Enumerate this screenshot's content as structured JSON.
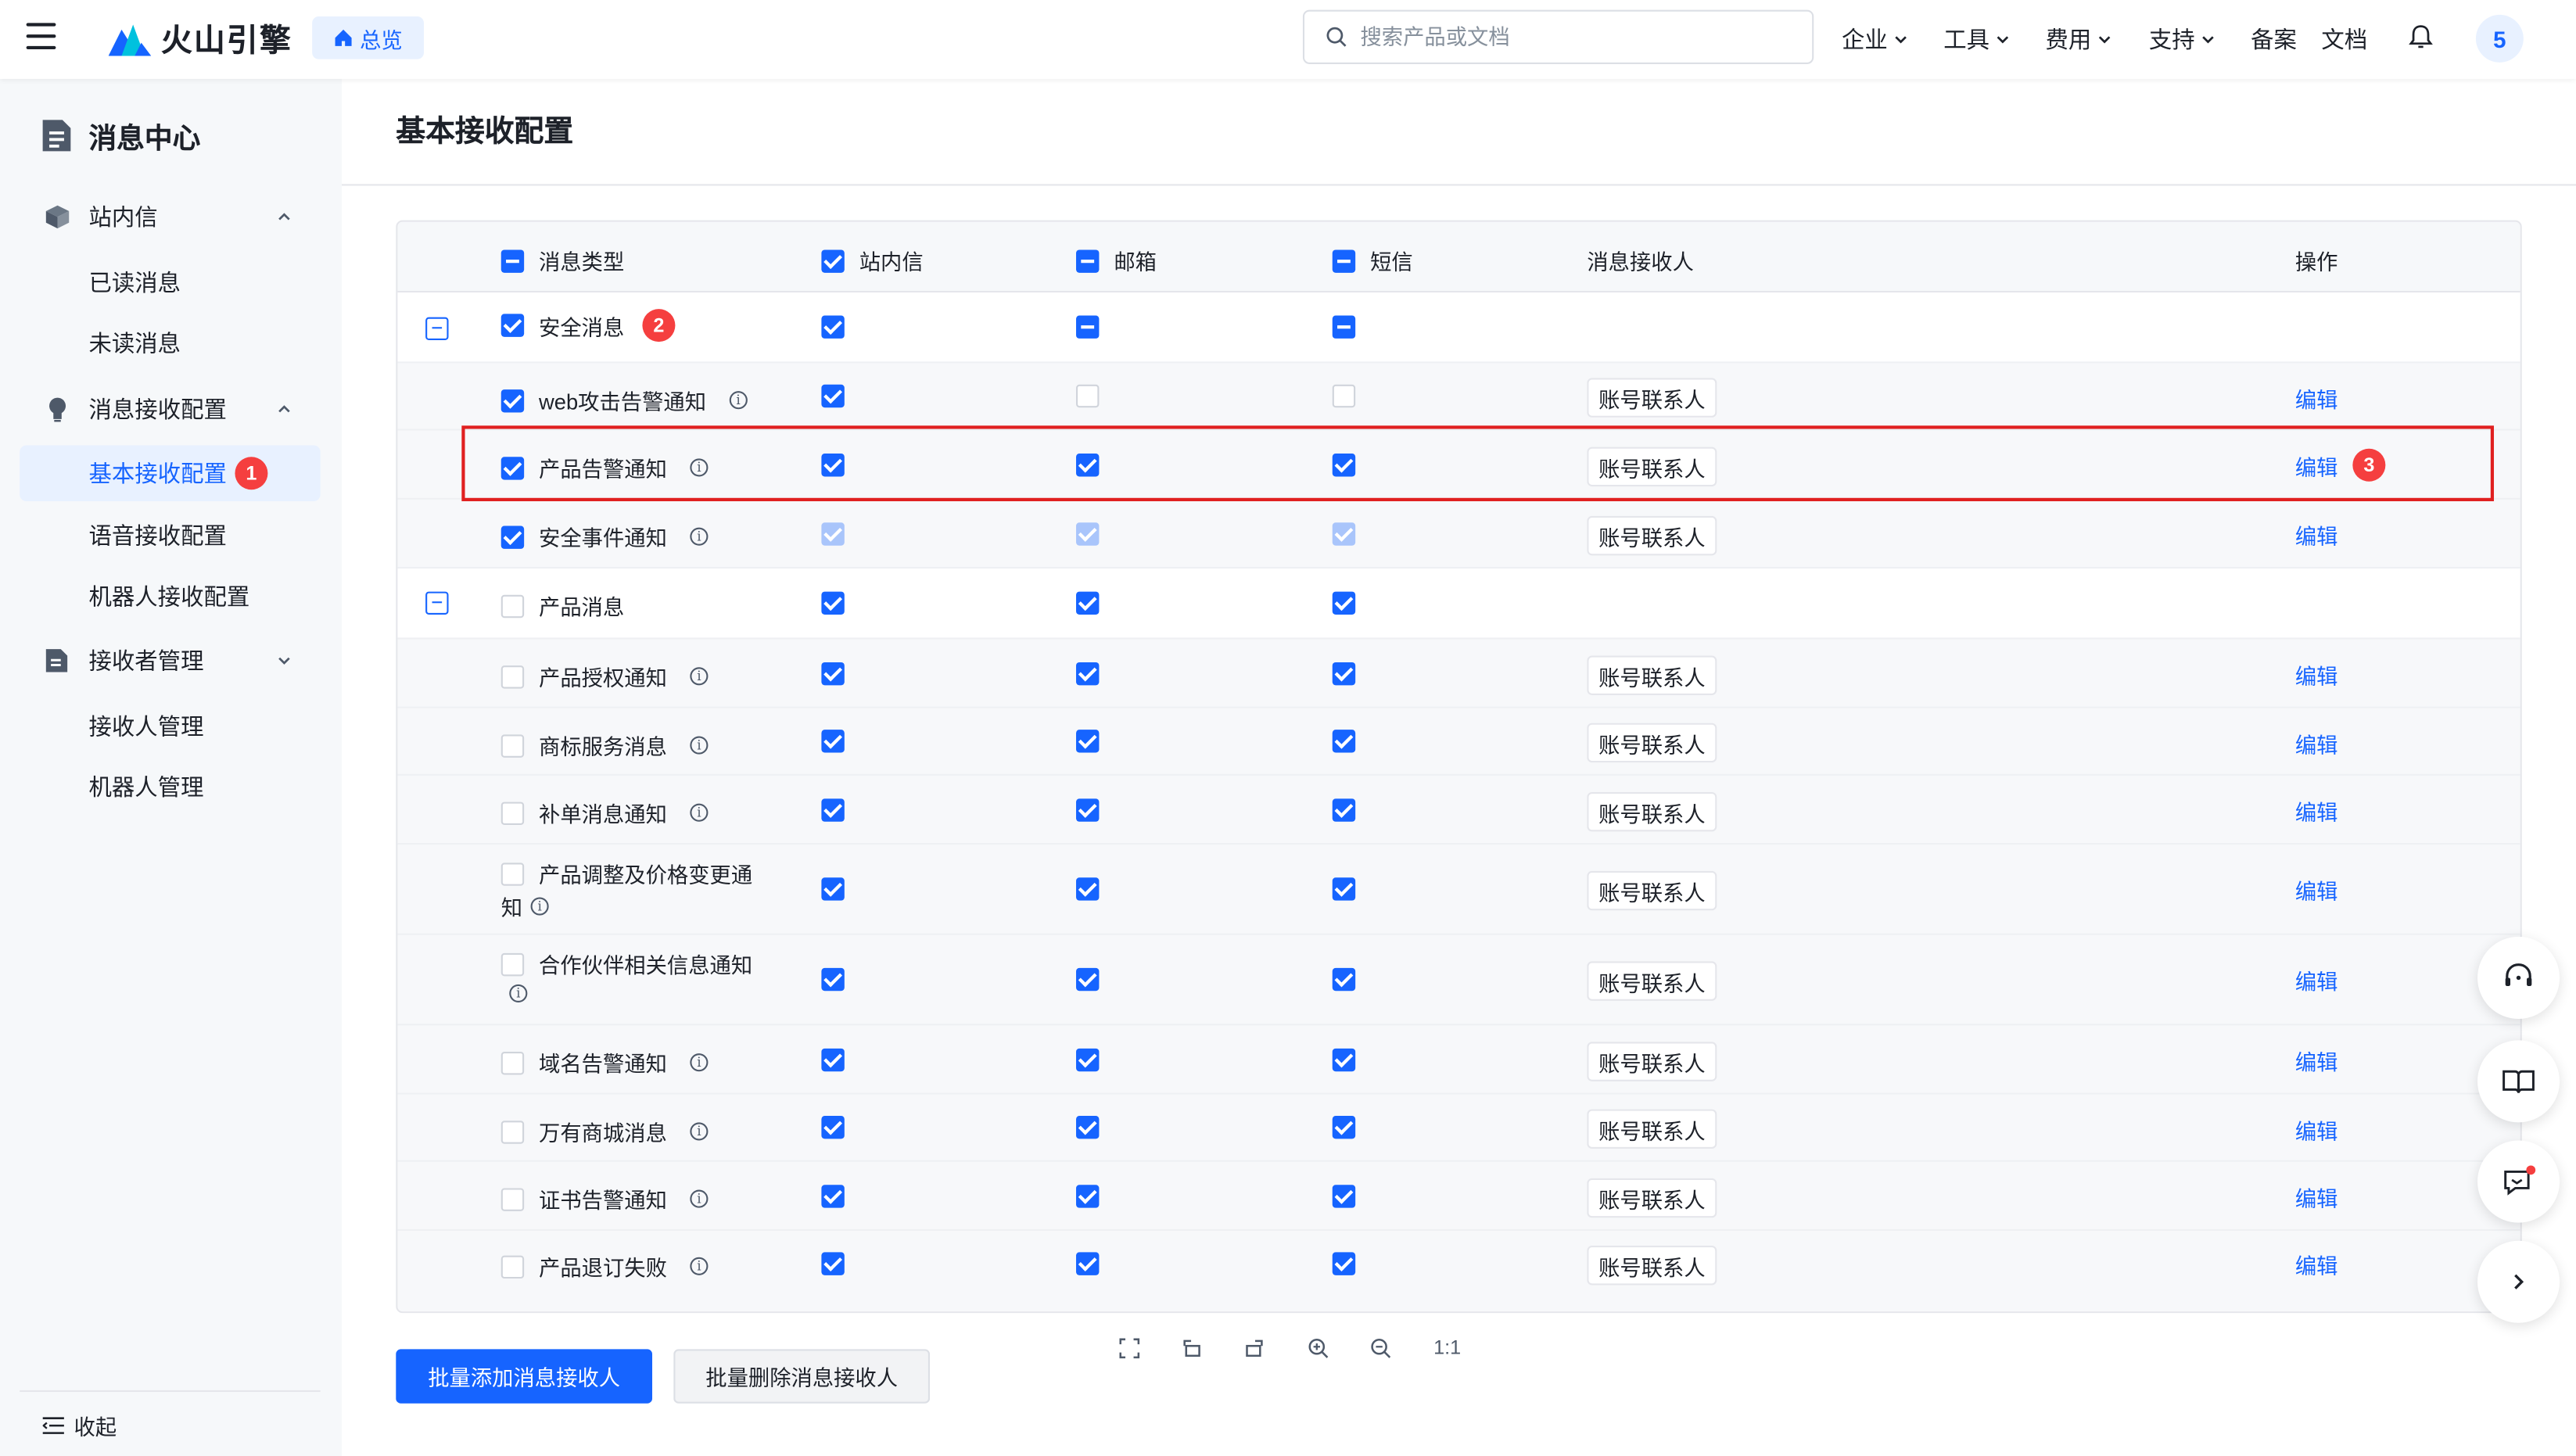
{
  "header": {
    "logo_text": "火山引擎",
    "home_label": "总览",
    "search_placeholder": "搜索产品或文档",
    "nav": [
      "企业",
      "工具",
      "费用",
      "支持",
      "备案",
      "文档"
    ],
    "avatar_text": "5"
  },
  "sidebar": {
    "title": "消息中心",
    "groups": [
      {
        "label": "站内信",
        "items": [
          "已读消息",
          "未读消息"
        ]
      },
      {
        "label": "消息接收配置",
        "items": [
          "基本接收配置",
          "语音接收配置",
          "机器人接收配置"
        ]
      },
      {
        "label": "接收者管理",
        "items": [
          "接收人管理",
          "机器人管理"
        ]
      }
    ],
    "active_item": "基本接收配置",
    "active_badge": "1",
    "collapse_label": "收起"
  },
  "page": {
    "title": "基本接收配置"
  },
  "table": {
    "columns": {
      "type": "消息类型",
      "inbox": "站内信",
      "email": "邮箱",
      "sms": "短信",
      "receiver": "消息接收人",
      "action": "操作"
    },
    "groups": [
      {
        "name": "安全消息",
        "badge": "2",
        "rows": [
          {
            "name": "web攻击告警通知",
            "receiver": "账号联系人",
            "action": "编辑"
          },
          {
            "name": "产品告警通知",
            "receiver": "账号联系人",
            "action": "编辑",
            "badge": "3"
          },
          {
            "name": "安全事件通知",
            "receiver": "账号联系人",
            "action": "编辑"
          }
        ]
      },
      {
        "name": "产品消息",
        "rows": [
          {
            "name": "产品授权通知",
            "receiver": "账号联系人",
            "action": "编辑"
          },
          {
            "name": "商标服务消息",
            "receiver": "账号联系人",
            "action": "编辑"
          },
          {
            "name": "补单消息通知",
            "receiver": "账号联系人",
            "action": "编辑"
          },
          {
            "name_line1": "产品调整及价格变更通",
            "name_line2": "知",
            "receiver": "账号联系人",
            "action": "编辑"
          },
          {
            "name_line1": "合作伙伴相关信息通知",
            "receiver": "账号联系人",
            "action": "编辑"
          },
          {
            "name": "域名告警通知",
            "receiver": "账号联系人",
            "action": "编辑"
          },
          {
            "name": "万有商城消息",
            "receiver": "账号联系人",
            "action": "编辑"
          },
          {
            "name": "证书告警通知",
            "receiver": "账号联系人",
            "action": "编辑"
          },
          {
            "name": "产品退订失败",
            "receiver": "账号联系人",
            "action": "编辑"
          }
        ]
      }
    ]
  },
  "buttons": {
    "add": "批量添加消息接收人",
    "delete": "批量删除消息接收人"
  },
  "zoom_label": "1:1",
  "colors": {
    "primary": "#1664ff",
    "highlight": "#e02020",
    "badge": "#f53f3f"
  }
}
